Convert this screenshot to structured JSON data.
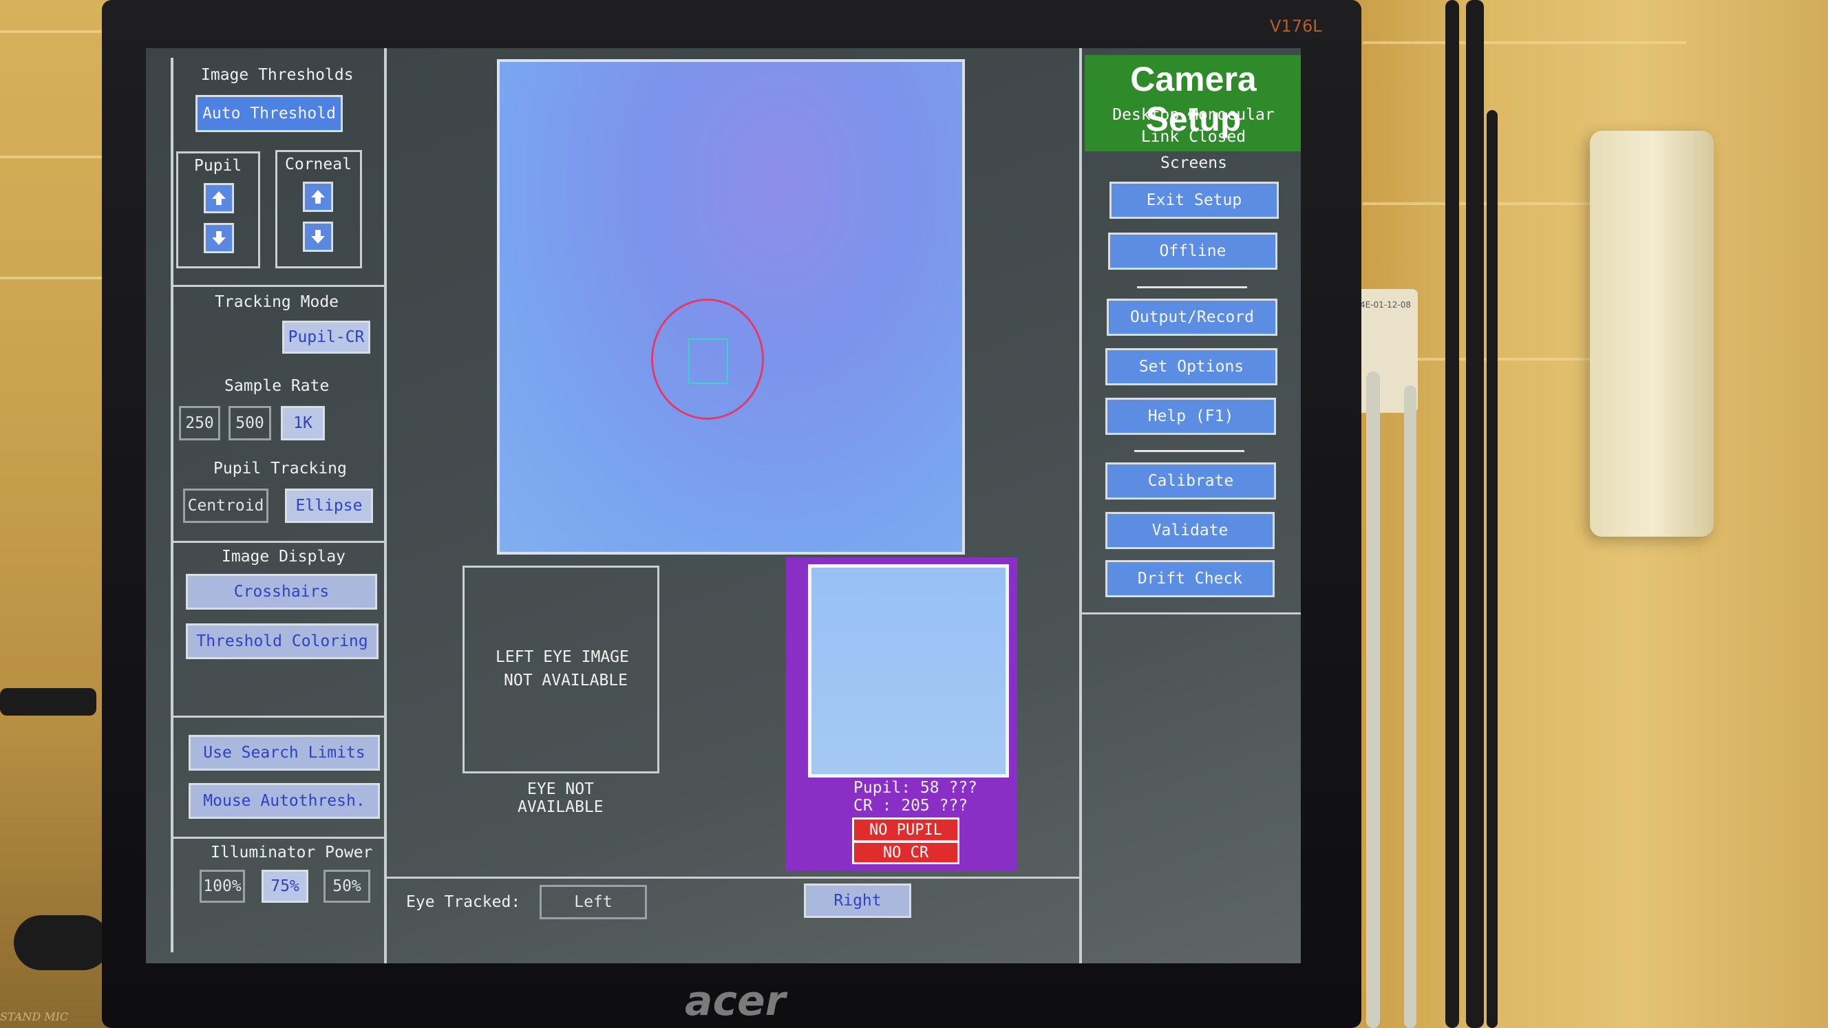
{
  "environment": {
    "monitor_model": "V176L",
    "brand": "acer",
    "mic_label": "STAND MIC",
    "wall_plate_label": "4E-01-12-08"
  },
  "left_panel": {
    "image_thresholds": {
      "title": "Image Thresholds",
      "auto_threshold": "Auto Threshold",
      "pupil_label": "Pupil",
      "corneal_label": "Corneal"
    },
    "tracking_mode": {
      "title": "Tracking Mode",
      "value": "Pupil-CR"
    },
    "sample_rate": {
      "title": "Sample Rate",
      "options": [
        "250",
        "500",
        "1K"
      ],
      "selected": "1K"
    },
    "pupil_tracking": {
      "title": "Pupil Tracking",
      "options": [
        "Centroid",
        "Ellipse"
      ],
      "selected": "Ellipse"
    },
    "image_display": {
      "title": "Image Display",
      "crosshairs": "Crosshairs",
      "threshold_coloring": "Threshold Coloring"
    },
    "search": {
      "use_search_limits": "Use Search Limits",
      "mouse_autothresh": "Mouse Autothresh."
    },
    "illuminator_power": {
      "title": "Illuminator Power",
      "options": [
        "100%",
        "75%",
        "50%"
      ],
      "selected": "75%"
    }
  },
  "center": {
    "left_eye_msg_1": "LEFT EYE IMAGE",
    "left_eye_msg_2": "NOT AVAILABLE",
    "eye_not_1": "EYE NOT",
    "eye_not_2": "AVAILABLE",
    "pupil_readout": "Pupil: 58  ???",
    "cr_readout": "CR   : 205 ???",
    "no_pupil": "NO PUPIL",
    "no_cr": "NO  CR",
    "eye_tracked_label": "Eye Tracked:",
    "eye_left": "Left",
    "eye_right": "Right"
  },
  "right_panel": {
    "title": "Camera Setup",
    "mode_line": "Desktop Monocular",
    "link_line": "Link Closed",
    "screens_label": "Screens",
    "exit_setup": "Exit Setup",
    "offline": "Offline",
    "output_record": "Output/Record",
    "set_options": "Set Options",
    "help": "Help (F1)",
    "calibrate": "Calibrate",
    "validate": "Validate",
    "drift_check": "Drift Check"
  }
}
